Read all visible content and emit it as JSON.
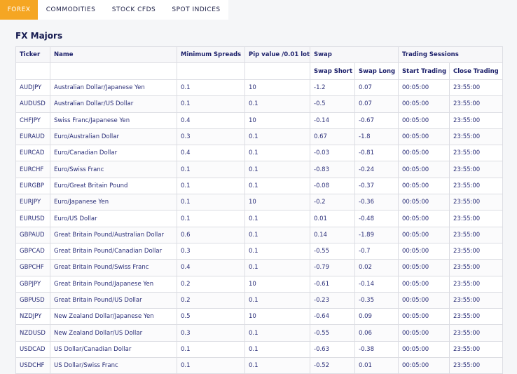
{
  "tabs": [
    {
      "label": "FOREX",
      "active": true
    },
    {
      "label": "COMMODITIES",
      "active": false
    },
    {
      "label": "STOCK CFDS",
      "active": false
    },
    {
      "label": "SPOT INDICES",
      "active": false
    }
  ],
  "colors": {
    "accent": "#f5a623",
    "text": "#1b1f6a",
    "border": "#dcdde3"
  },
  "section_title": "FX Majors",
  "table": {
    "headers": {
      "ticker": "Ticker",
      "name": "Name",
      "min_spreads": "Minimum Spreads",
      "pip_value": "Pip value /0.01 lot",
      "swap": "Swap",
      "trading_sessions": "Trading Sessions",
      "swap_short": "Swap Short",
      "swap_long": "Swap Long",
      "start_trading": "Start Trading",
      "close_trading": "Close Trading"
    },
    "rows": [
      {
        "ticker": "AUDJPY",
        "name": "Australian Dollar/Japanese Yen",
        "spread": "0.1",
        "pip": "10",
        "short": "-1.2",
        "long": "0.07",
        "start": "00:05:00",
        "close": "23:55:00"
      },
      {
        "ticker": "AUDUSD",
        "name": "Australian Dollar/US Dollar",
        "spread": "0.1",
        "pip": "0.1",
        "short": "-0.5",
        "long": "0.07",
        "start": "00:05:00",
        "close": "23:55:00"
      },
      {
        "ticker": "CHFJPY",
        "name": "Swiss Franc/Japanese Yen",
        "spread": "0.4",
        "pip": "10",
        "short": "-0.14",
        "long": "-0.67",
        "start": "00:05:00",
        "close": "23:55:00"
      },
      {
        "ticker": "EURAUD",
        "name": "Euro/Australian Dollar",
        "spread": "0.3",
        "pip": "0.1",
        "short": "0.67",
        "long": "-1.8",
        "start": "00:05:00",
        "close": "23:55:00"
      },
      {
        "ticker": "EURCAD",
        "name": "Euro/Canadian Dollar",
        "spread": "0.4",
        "pip": "0.1",
        "short": "-0.03",
        "long": "-0.81",
        "start": "00:05:00",
        "close": "23:55:00"
      },
      {
        "ticker": "EURCHF",
        "name": "Euro/Swiss Franc",
        "spread": "0.1",
        "pip": "0.1",
        "short": "-0.83",
        "long": "-0.24",
        "start": "00:05:00",
        "close": "23:55:00"
      },
      {
        "ticker": "EURGBP",
        "name": "Euro/Great Britain Pound",
        "spread": "0.1",
        "pip": "0.1",
        "short": "-0.08",
        "long": "-0.37",
        "start": "00:05:00",
        "close": "23:55:00"
      },
      {
        "ticker": "EURJPY",
        "name": "Euro/Japanese Yen",
        "spread": "0.1",
        "pip": "10",
        "short": "-0.2",
        "long": "-0.36",
        "start": "00:05:00",
        "close": "23:55:00"
      },
      {
        "ticker": "EURUSD",
        "name": "Euro/US Dollar",
        "spread": "0.1",
        "pip": "0.1",
        "short": "0.01",
        "long": "-0.48",
        "start": "00:05:00",
        "close": "23:55:00"
      },
      {
        "ticker": "GBPAUD",
        "name": "Great Britain Pound/Australian Dollar",
        "spread": "0.6",
        "pip": "0.1",
        "short": "0.14",
        "long": "-1.89",
        "start": "00:05:00",
        "close": "23:55:00"
      },
      {
        "ticker": "GBPCAD",
        "name": "Great Britain Pound/Canadian Dollar",
        "spread": "0.3",
        "pip": "0.1",
        "short": "-0.55",
        "long": "-0.7",
        "start": "00:05:00",
        "close": "23:55:00"
      },
      {
        "ticker": "GBPCHF",
        "name": "Great Britain Pound/Swiss Franc",
        "spread": "0.4",
        "pip": "0.1",
        "short": "-0.79",
        "long": "0.02",
        "start": "00:05:00",
        "close": "23:55:00"
      },
      {
        "ticker": "GBPJPY",
        "name": "Great Britain Pound/Japanese Yen",
        "spread": "0.2",
        "pip": "10",
        "short": "-0.61",
        "long": "-0.14",
        "start": "00:05:00",
        "close": "23:55:00"
      },
      {
        "ticker": "GBPUSD",
        "name": "Great Britain Pound/US Dollar",
        "spread": "0.2",
        "pip": "0.1",
        "short": "-0.23",
        "long": "-0.35",
        "start": "00:05:00",
        "close": "23:55:00"
      },
      {
        "ticker": "NZDJPY",
        "name": "New Zealand Dollar/Japanese Yen",
        "spread": "0.5",
        "pip": "10",
        "short": "-0.64",
        "long": "0.09",
        "start": "00:05:00",
        "close": "23:55:00"
      },
      {
        "ticker": "NZDUSD",
        "name": "New Zealand Dollar/US Dollar",
        "spread": "0.3",
        "pip": "0.1",
        "short": "-0.55",
        "long": "0.06",
        "start": "00:05:00",
        "close": "23:55:00"
      },
      {
        "ticker": "USDCAD",
        "name": "US Dollar/Canadian Dollar",
        "spread": "0.1",
        "pip": "0.1",
        "short": "-0.63",
        "long": "-0.38",
        "start": "00:05:00",
        "close": "23:55:00"
      },
      {
        "ticker": "USDCHF",
        "name": "US Dollar/Swiss Franc",
        "spread": "0.1",
        "pip": "0.1",
        "short": "-0.52",
        "long": "0.01",
        "start": "00:05:00",
        "close": "23:55:00"
      }
    ]
  }
}
